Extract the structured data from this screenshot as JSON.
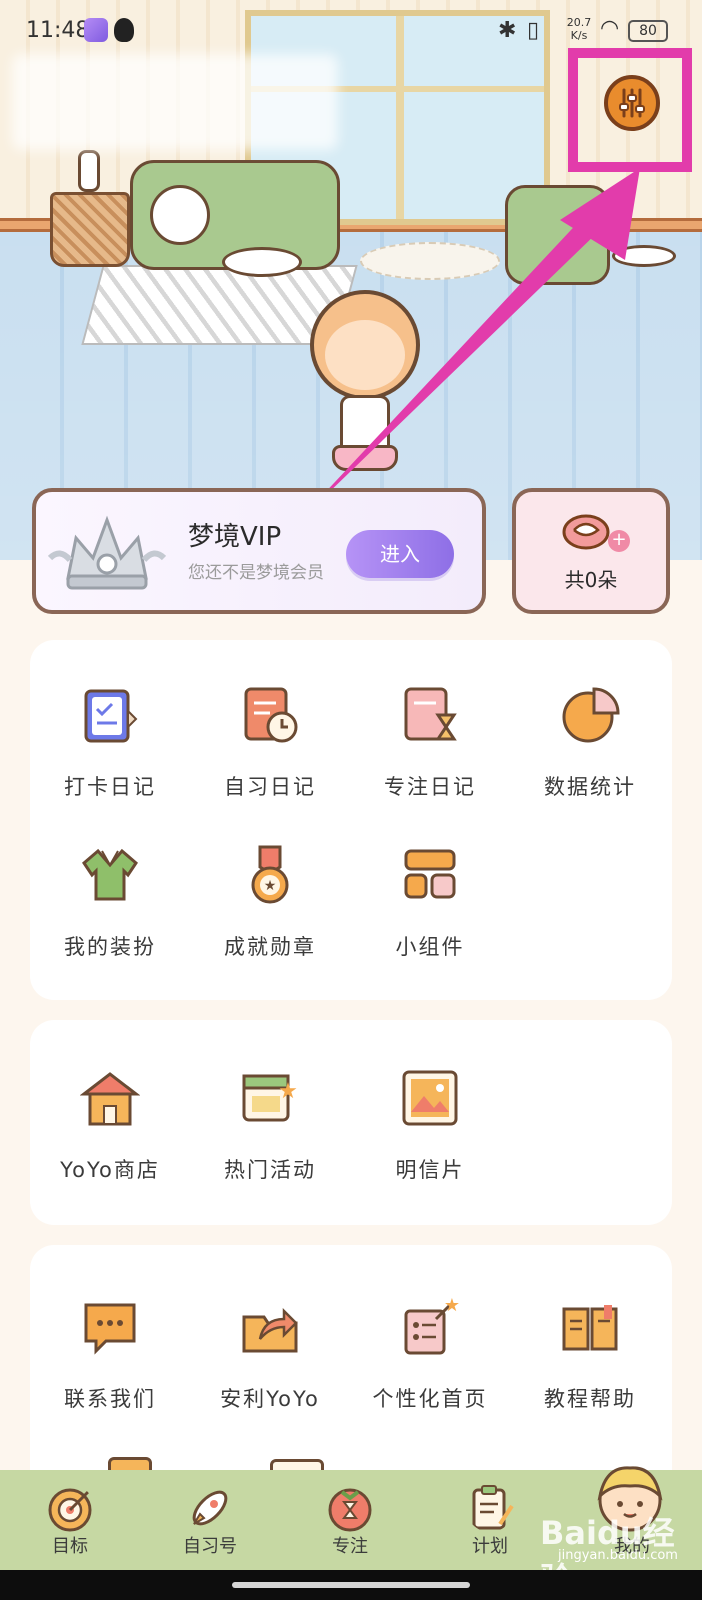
{
  "status_bar": {
    "time": "11:48",
    "network_speed": "20.7\nK/s",
    "battery": "80"
  },
  "header": {
    "settings_icon": "sliders-icon"
  },
  "vip": {
    "title": "梦境VIP",
    "subtitle": "您还不是梦境会员",
    "enter_label": "进入"
  },
  "flowers": {
    "count_label": "共0朵"
  },
  "section1": {
    "items": [
      {
        "label": "打卡日记",
        "icon": "checklist-book-icon"
      },
      {
        "label": "自习日记",
        "icon": "clock-book-icon"
      },
      {
        "label": "专注日记",
        "icon": "hourglass-book-icon"
      },
      {
        "label": "数据统计",
        "icon": "pie-chart-icon"
      },
      {
        "label": "我的装扮",
        "icon": "shirt-icon"
      },
      {
        "label": "成就勋章",
        "icon": "medal-icon"
      },
      {
        "label": "小组件",
        "icon": "widget-icon"
      }
    ]
  },
  "section2": {
    "items": [
      {
        "label": "YoYo商店",
        "icon": "shop-icon"
      },
      {
        "label": "热门活动",
        "icon": "calendar-star-icon"
      },
      {
        "label": "明信片",
        "icon": "picture-icon"
      }
    ]
  },
  "section3": {
    "items": [
      {
        "label": "联系我们",
        "icon": "chat-bubble-icon"
      },
      {
        "label": "安利YoYo",
        "icon": "share-folder-icon"
      },
      {
        "label": "个性化首页",
        "icon": "magic-wand-icon"
      },
      {
        "label": "教程帮助",
        "icon": "open-book-icon"
      }
    ]
  },
  "bottom_nav": {
    "items": [
      {
        "label": "目标",
        "icon": "target-icon"
      },
      {
        "label": "自习号",
        "icon": "rocket-icon"
      },
      {
        "label": "专注",
        "icon": "tomato-timer-icon"
      },
      {
        "label": "计划",
        "icon": "clipboard-icon"
      },
      {
        "label": "我的",
        "icon": "avatar-icon"
      }
    ]
  },
  "watermark": {
    "brand": "Baidu经验",
    "url": "jingyan.baidu.com"
  },
  "colors": {
    "accent_purple": "#9b7bec",
    "highlight_magenta": "#e23cab",
    "nav_green": "#c6d8a3",
    "card_border": "#8a6656"
  }
}
